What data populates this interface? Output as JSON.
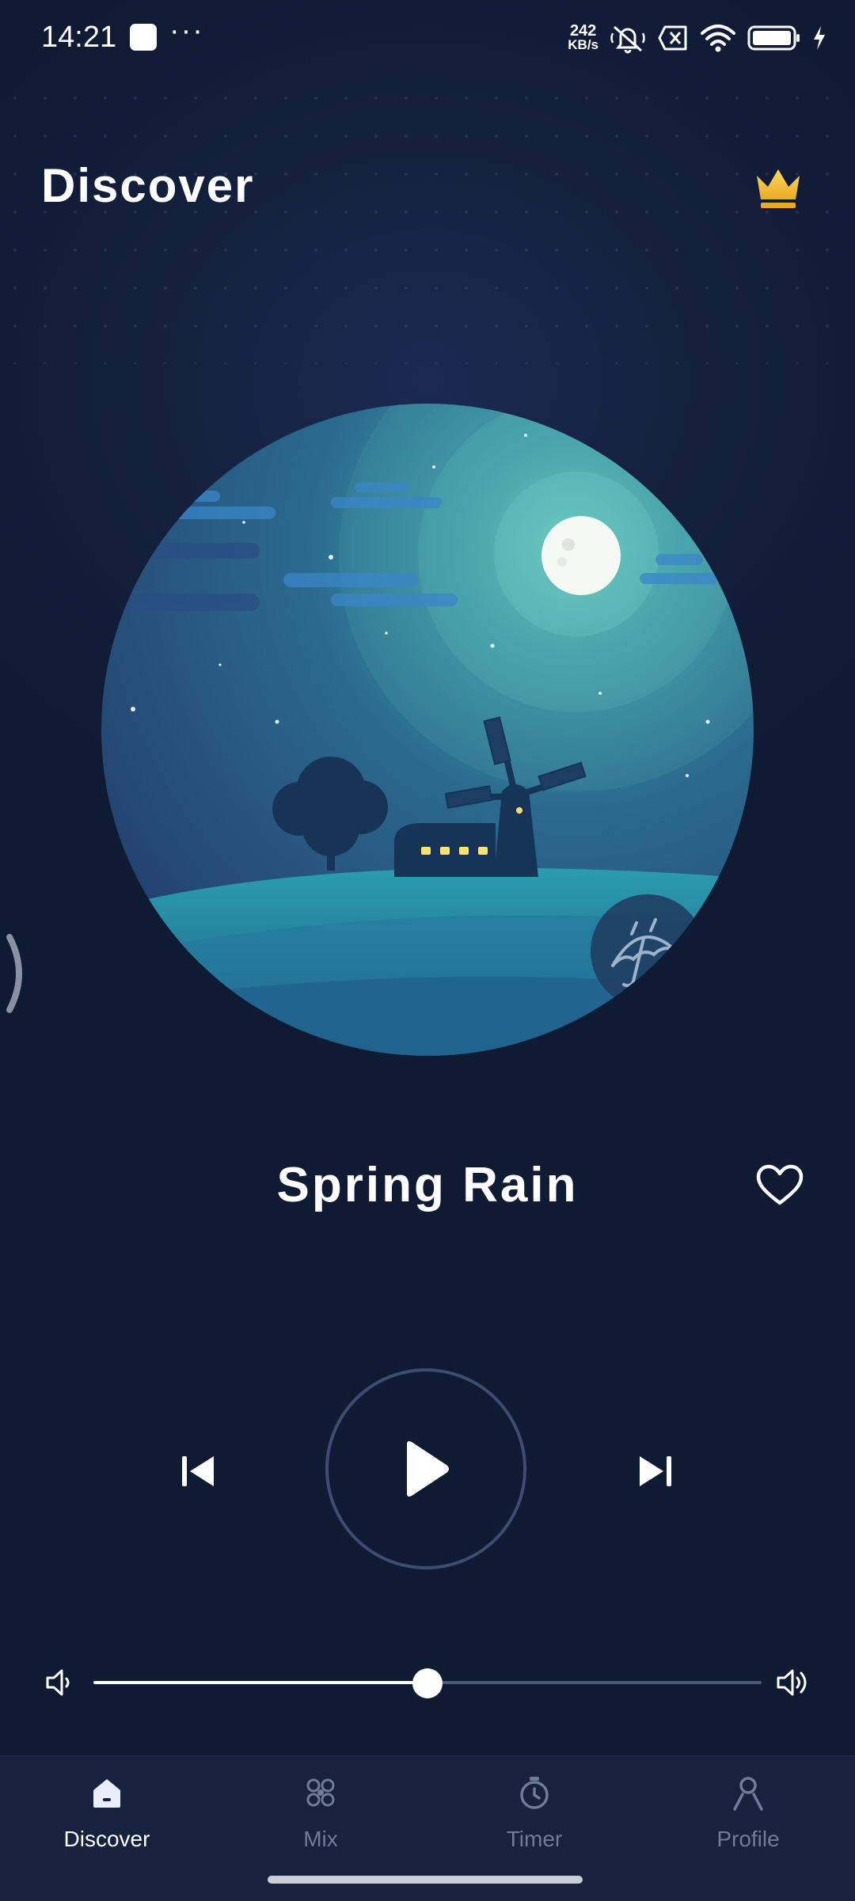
{
  "status_bar": {
    "time": "14:21",
    "more": "···",
    "net_speed_value": "242",
    "net_speed_unit": "KB/s",
    "icons": [
      "notification-square-icon",
      "mute-icon",
      "no-sim-icon",
      "wifi-icon",
      "battery-icon",
      "charging-icon"
    ]
  },
  "header": {
    "title": "Discover",
    "premium_icon": "crown-icon"
  },
  "player": {
    "artwork_icon": "night-windmill-illustration",
    "category_badge_icon": "umbrella-rain-icon",
    "track_title": "Spring Rain",
    "favorite_icon": "heart-icon",
    "controls": {
      "previous_icon": "skip-previous-icon",
      "play_icon": "play-icon",
      "next_icon": "skip-next-icon"
    },
    "volume": {
      "level": 0.5,
      "low_icon": "volume-low-icon",
      "high_icon": "volume-high-icon"
    }
  },
  "bottom_nav": {
    "items": [
      {
        "label": "Discover",
        "icon": "home-icon",
        "active": true
      },
      {
        "label": "Mix",
        "icon": "mix-icon",
        "active": false
      },
      {
        "label": "Timer",
        "icon": "timer-icon",
        "active": false
      },
      {
        "label": "Profile",
        "icon": "profile-icon",
        "active": false
      }
    ]
  },
  "colors": {
    "background": "#0f1a33",
    "accent_gold": "#f6c342",
    "nav_inactive": "#6f7b9b",
    "nav_background": "#17223e"
  }
}
